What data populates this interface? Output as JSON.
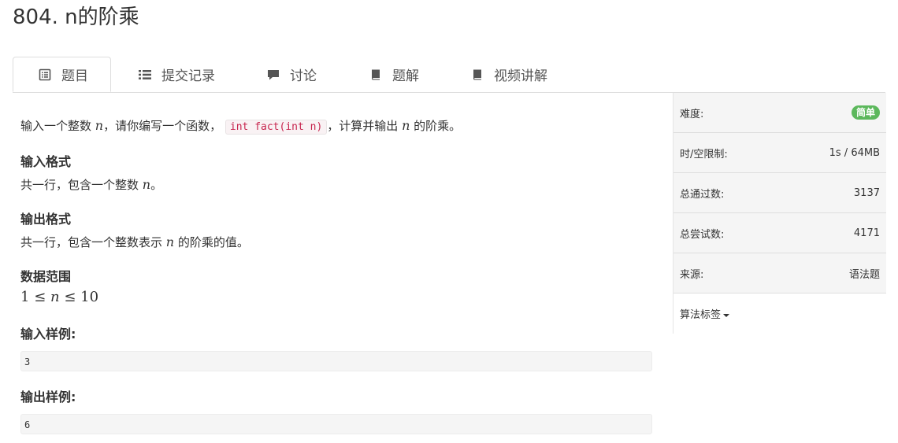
{
  "problem": {
    "title": "804. n的阶乘"
  },
  "tabs": [
    {
      "label": "题目",
      "icon": "list-icon",
      "active": true
    },
    {
      "label": "提交记录",
      "icon": "bulleted-list-icon",
      "active": false
    },
    {
      "label": "讨论",
      "icon": "comment-icon",
      "active": false
    },
    {
      "label": "题解",
      "icon": "book-icon",
      "active": false
    },
    {
      "label": "视频讲解",
      "icon": "book-icon",
      "active": false
    }
  ],
  "description": {
    "part1": "输入一个整数 ",
    "var": "n",
    "part2": "，请你编写一个函数，",
    "code": "int fact(int n)",
    "part3": "，计算并输出 ",
    "part4": " 的阶乘。"
  },
  "input_format": {
    "heading": "输入格式",
    "text1": "共一行，包含一个整数 ",
    "var": "n",
    "text2": "。"
  },
  "output_format": {
    "heading": "输出格式",
    "text1": "共一行，包含一个整数表示 ",
    "var": "n",
    "text2": " 的阶乘的值。"
  },
  "data_range": {
    "heading": "数据范围",
    "lower": "1",
    "op1": "≤",
    "var": "n",
    "op2": "≤",
    "upper": "10"
  },
  "sample_input": {
    "heading": "输入样例:",
    "value": "3"
  },
  "sample_output": {
    "heading": "输出样例:",
    "value": "6"
  },
  "sidebar": {
    "difficulty_label": "难度:",
    "difficulty_value": "简单",
    "limit_label": "时/空限制:",
    "limit_value": "1s / 64MB",
    "accepted_label": "总通过数:",
    "accepted_value": "3137",
    "attempts_label": "总尝试数:",
    "attempts_value": "4171",
    "source_label": "来源:",
    "source_value": "语法题",
    "tags_label": "算法标签"
  },
  "colors": {
    "badge_easy": "#5cb85c",
    "code_text": "#c7254e"
  }
}
